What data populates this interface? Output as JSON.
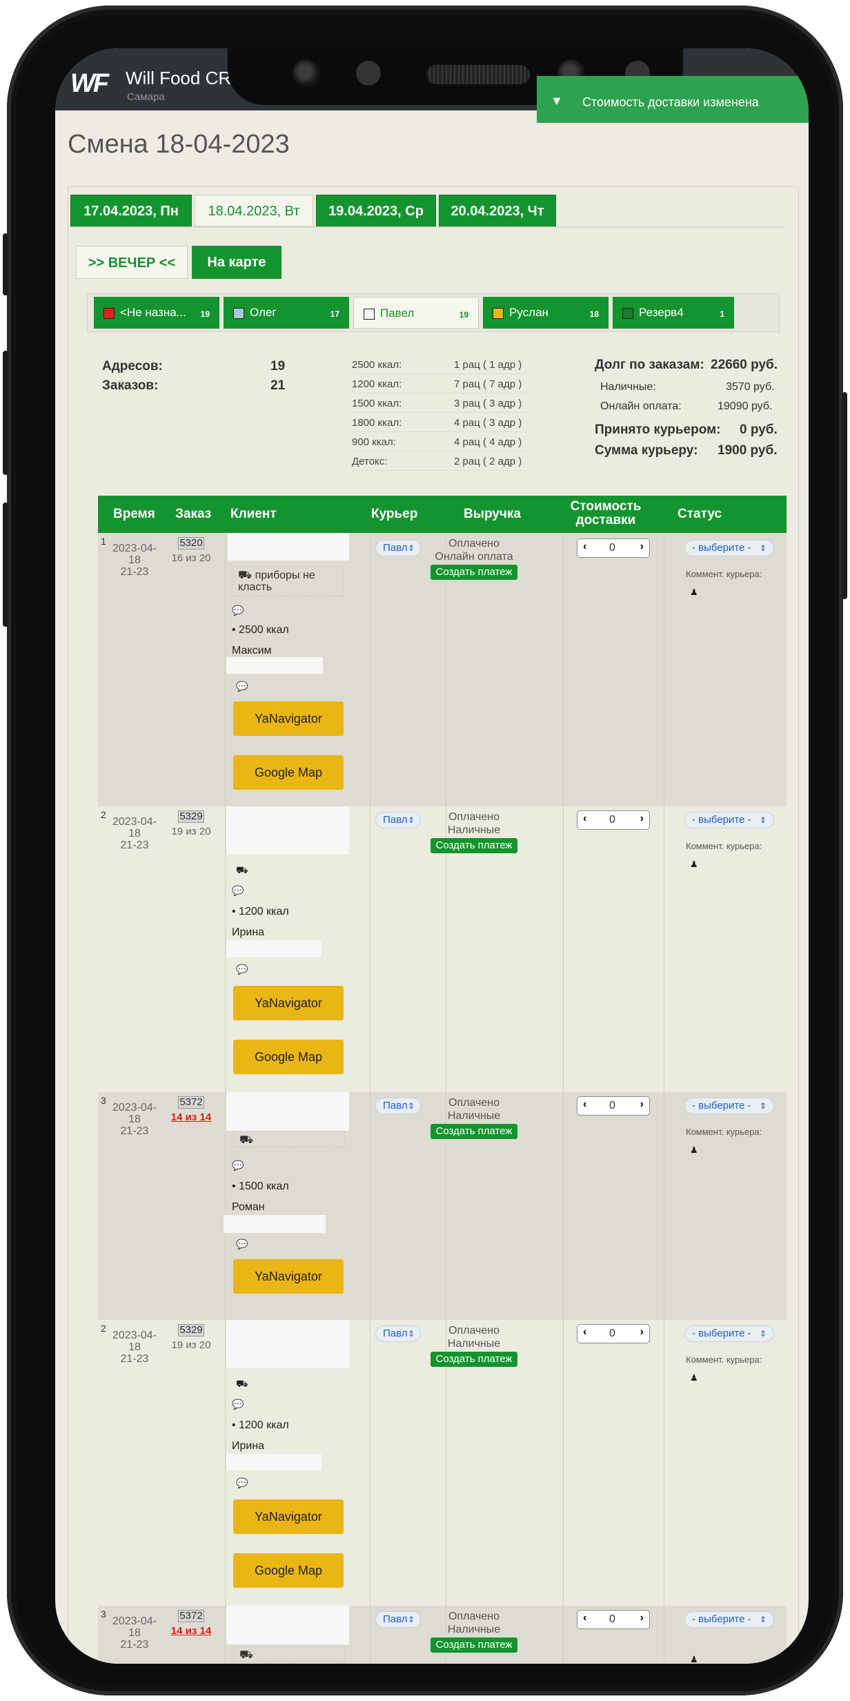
{
  "app": {
    "logo": "WF",
    "title": "Will Food CR",
    "city": "Самара"
  },
  "toast": {
    "message": "Стоимость доставки изменена"
  },
  "page": {
    "title": "Смена 18-04-2023"
  },
  "date_tabs": [
    "17.04.2023, Пн",
    "18.04.2023, Вт",
    "19.04.2023, Ср",
    "20.04.2023, Чт"
  ],
  "date_tab_active": 1,
  "sub_tabs": {
    "evening": ">> ВЕЧЕР <<",
    "map": "На карте"
  },
  "couriers": [
    {
      "name": "<Не назна...",
      "count": "19",
      "color": "#e02020"
    },
    {
      "name": "Олег",
      "count": "17",
      "color": "#a9c8d8"
    },
    {
      "name": "Павел",
      "count": "19",
      "color": "#f4f4f4",
      "active": true
    },
    {
      "name": "Руслан",
      "count": "18",
      "color": "#eab615"
    },
    {
      "name": "Резерв4",
      "count": "1",
      "color": "#1a7a2a"
    }
  ],
  "summary": {
    "addresses_label": "Адресов:",
    "addresses": "19",
    "orders_label": "Заказов:",
    "orders": "21",
    "kcal": [
      {
        "label": "2500 ккал:",
        "value": "1 рац ( 1 адр )"
      },
      {
        "label": "1200 ккал:",
        "value": "7 рац ( 7 адр )"
      },
      {
        "label": "1500 ккал:",
        "value": "3 рац ( 3 адр )"
      },
      {
        "label": "1800 ккал:",
        "value": "4 рац ( 3 адр )"
      },
      {
        "label": "900 ккал:",
        "value": "4 рац ( 4 адр )"
      },
      {
        "label": "Детокс:",
        "value": "2 рац ( 2 адр )"
      }
    ],
    "debt_label": "Долг по заказам:",
    "debt": "22660 руб.",
    "cash_label": "Наличные:",
    "cash": "3570 руб.",
    "online_label": "Онлайн оплата:",
    "online": "19090 руб.",
    "accepted_label": "Принято курьером:",
    "accepted": "0 руб.",
    "courier_sum_label": "Сумма курьеру:",
    "courier_sum": "1900 руб."
  },
  "table": {
    "headers": {
      "time": "Время",
      "order": "Заказ",
      "client": "Клиент",
      "courier": "Курьер",
      "revenue": "Выручка",
      "delivery_cost": "Стоимость доставки",
      "status": "Статус"
    },
    "rows": [
      {
        "num": "1",
        "date": "2023-04-",
        "date2": "18",
        "time": "21-23",
        "order_id": "5320",
        "order_count": "16 из 20",
        "note": "приборы не класть",
        "kcal": "• 2500 ккал",
        "name": "Максим",
        "courier": "Павл",
        "pay1": "Оплачено",
        "pay2": "Онлайн оплата",
        "pay_button": "Создать платеж",
        "cost": "0",
        "status": "- выберите -",
        "comment": "Коммент. курьера:",
        "yanavigator": "YaNavigator",
        "googlemap": "Google Map"
      },
      {
        "num": "2",
        "date": "2023-04-",
        "date2": "18",
        "time": "21-23",
        "order_id": "5329",
        "order_count": "19 из 20",
        "kcal": "• 1200 ккал",
        "name": "Ирина",
        "courier": "Павл",
        "pay1": "Оплачено",
        "pay2": "Наличные",
        "pay_button": "Создать платеж",
        "cost": "0",
        "status": "- выберите -",
        "comment": "Коммент. курьера:",
        "yanavigator": "YaNavigator",
        "googlemap": "Google Map"
      },
      {
        "num": "3",
        "date": "2023-04-",
        "date2": "18",
        "time": "21-23",
        "order_id": "5372",
        "order_count": "14 из 14",
        "kcal": "• 1500 ккал",
        "name": "Роман",
        "courier": "Павл",
        "pay1": "Оплачено",
        "pay2": "Наличные",
        "pay_button": "Создать платеж",
        "cost": "0",
        "status": "- выберите -",
        "comment": "Коммент. курьера:",
        "yanavigator": "YaNavigator"
      },
      {
        "num": "2",
        "date": "2023-04-",
        "date2": "18",
        "time": "21-23",
        "order_id": "5329",
        "order_count": "19 из 20",
        "kcal": "• 1200 ккал",
        "name": "Ирина",
        "courier": "Павл",
        "pay1": "Оплачено",
        "pay2": "Наличные",
        "pay_button": "Создать платеж",
        "cost": "0",
        "status": "- выберите -",
        "comment": "Коммент. курьера:",
        "yanavigator": "YaNavigator",
        "googlemap": "Google Map"
      },
      {
        "num": "3",
        "date": "2023-04-",
        "date2": "18",
        "time": "21-23",
        "order_id": "5372",
        "order_count": "14 из 14",
        "courier": "Павл",
        "pay1": "Оплачено",
        "pay2": "Наличные",
        "pay_button": "Создать платеж",
        "cost": "0",
        "status": "- выберите -"
      }
    ]
  }
}
